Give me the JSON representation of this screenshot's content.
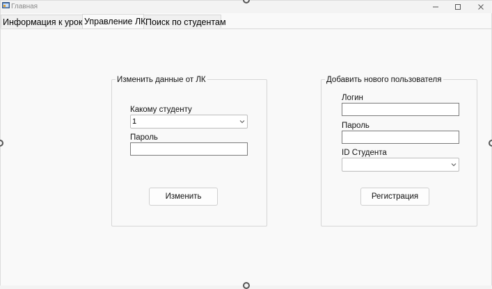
{
  "window": {
    "title": "Главная",
    "minimize_icon": "minimize-icon",
    "maximize_icon": "maximize-icon",
    "close_icon": "close-icon"
  },
  "tabs": [
    {
      "label": "Информация к уроку"
    },
    {
      "label": "Управление ЛК"
    },
    {
      "label": "Поиск по студентам"
    }
  ],
  "change_group": {
    "title": "Изменить данные от ЛК",
    "student_label": "Какому студенту",
    "student_value": "1",
    "password_label": "Пароль",
    "password_value": "",
    "submit_label": "Изменить"
  },
  "add_group": {
    "title": "Добавить нового пользователя",
    "login_label": "Логин",
    "login_value": "",
    "password_label": "Пароль",
    "password_value": "",
    "student_id_label": "ID Студента",
    "student_id_value": "",
    "submit_label": "Регистрация"
  },
  "colors": {
    "background": "#f9f9f9",
    "border": "#d6d6d6",
    "textbox_border": "#7a7a7a"
  }
}
